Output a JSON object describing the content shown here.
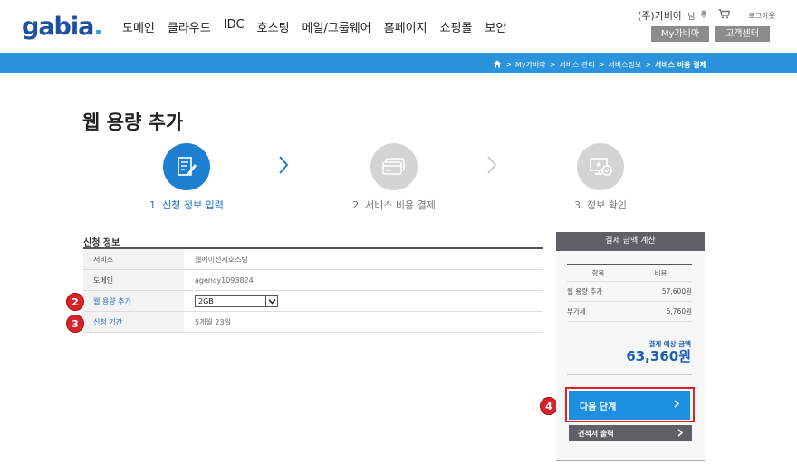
{
  "header": {
    "logo": "gabia",
    "logo_dot": ".",
    "nav": [
      "도메인",
      "클라우드",
      "IDC",
      "호스팅",
      "메일/그룹웨어",
      "홈페이지",
      "쇼핑몰",
      "보안"
    ],
    "user_name": "(주)가비아",
    "user_suffix": "님",
    "logout": "로그아웃",
    "my_gabia": "My가비아",
    "customer_center": "고객센터"
  },
  "breadcrumb": {
    "items": [
      "My가비아",
      "서비스 관리",
      "서비스정보"
    ],
    "current": "서비스 비용 결제",
    "sep": ">"
  },
  "page": {
    "title": "웹 용량 추가"
  },
  "steps": [
    {
      "label": "1. 신청 정보 입력",
      "state": "active"
    },
    {
      "label": "2. 서비스 비용 결제",
      "state": "inactive"
    },
    {
      "label": "3. 정보 확인",
      "state": "inactive"
    }
  ],
  "form": {
    "section_title": "신청 정보",
    "rows": [
      {
        "label": "서비스",
        "value": "웹에이전시호스팅"
      },
      {
        "label": "도메인",
        "value": "agency1093824"
      },
      {
        "label": "웹 용량 추가",
        "value": "2GB"
      },
      {
        "label": "신청 기간",
        "value": "5개월 23일"
      }
    ]
  },
  "badges": [
    "2",
    "3",
    "4"
  ],
  "summary": {
    "title": "결제 금액 계산",
    "col_item": "항목",
    "col_cost": "비용",
    "rows": [
      {
        "item": "웹 용량 추가",
        "cost": "57,600원"
      },
      {
        "item": "부가세",
        "cost": "5,760원"
      }
    ],
    "total_label": "결제 예상 금액",
    "total_value": "63,360원",
    "next_button": "다음 단계",
    "estimate_button": "견적서 출력"
  },
  "colors": {
    "brand_blue": "#2a93dc",
    "logo_blue": "#1f4fa0",
    "highlight_red": "#d8232a"
  }
}
